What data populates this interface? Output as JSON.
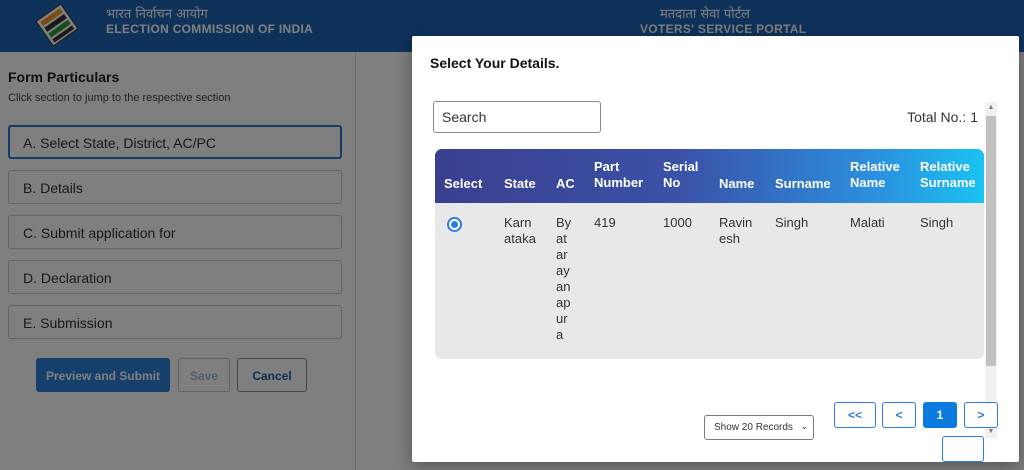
{
  "header": {
    "org_hindi": "भारत निर्वाचन आयोग",
    "org_english": "ELECTION COMMISSION OF INDIA",
    "portal_hindi": "मतदाता सेवा पोर्टल",
    "portal_english": "VOTERS' SERVICE PORTAL",
    "logo_icon": "eci-ballot-logo-icon",
    "bg_color": "#1f65b7"
  },
  "form": {
    "title": "Form Particulars",
    "subtitle": "Click section to jump to the respective section",
    "sections": [
      {
        "label": "A. Select State, District, AC/PC",
        "active": true
      },
      {
        "label": "B. Details",
        "active": false
      },
      {
        "label": "C. Submit application for",
        "active": false
      },
      {
        "label": "D. Declaration",
        "active": false
      },
      {
        "label": "E. Submission",
        "active": false
      }
    ],
    "buttons": {
      "preview_submit": "Preview and Submit",
      "save": "Save",
      "cancel": "Cancel"
    }
  },
  "modal": {
    "title": "Select Your Details.",
    "search_placeholder": "Search",
    "total_label": "Total No.:",
    "total_value": "1",
    "columns": [
      "Select",
      "State",
      "AC",
      "Part Number",
      "Serial No",
      "Name",
      "Surname",
      "Relative Name",
      "Relative Surname"
    ],
    "rows": [
      {
        "selected": true,
        "state": "Karnataka",
        "ac": "Byatarayanapura",
        "part_number": "419",
        "serial_no": "1000",
        "name": "Ravinesh",
        "surname": "Singh",
        "relative_name": "Malati",
        "relative_surname": "Singh"
      }
    ],
    "records_select": "Show 20 Records",
    "pagination": {
      "first": "<<",
      "prev": "<",
      "current": "1",
      "next": ">"
    },
    "accent_color": "#2a7be4"
  }
}
